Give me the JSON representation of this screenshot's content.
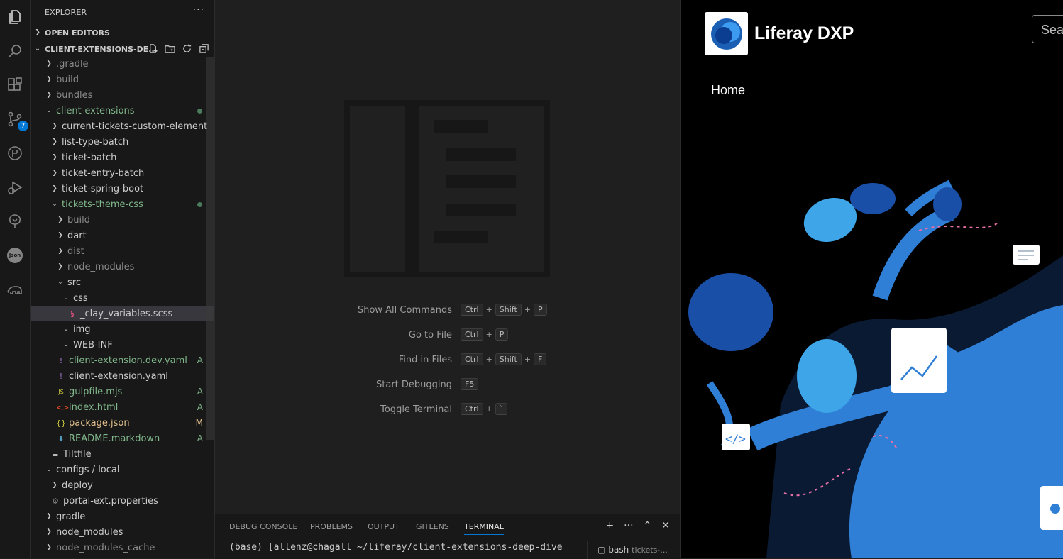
{
  "sidebar": {
    "title": "EXPLORER",
    "open_editors": "OPEN EDITORS",
    "workspace": "CLIENT-EXTENSIONS-DE...",
    "tree": [
      {
        "label": ".gradle",
        "depth": 0,
        "kind": "folder",
        "open": false,
        "color": "dim"
      },
      {
        "label": "build",
        "depth": 0,
        "kind": "folder",
        "open": false,
        "color": "dim"
      },
      {
        "label": "bundles",
        "depth": 0,
        "kind": "folder",
        "open": false,
        "color": "dim"
      },
      {
        "label": "client-extensions",
        "depth": 0,
        "kind": "folder",
        "open": true,
        "color": "green",
        "dot": true
      },
      {
        "label": "current-tickets-custom-element",
        "depth": 1,
        "kind": "folder",
        "open": false
      },
      {
        "label": "list-type-batch",
        "depth": 1,
        "kind": "folder",
        "open": false
      },
      {
        "label": "ticket-batch",
        "depth": 1,
        "kind": "folder",
        "open": false
      },
      {
        "label": "ticket-entry-batch",
        "depth": 1,
        "kind": "folder",
        "open": false
      },
      {
        "label": "ticket-spring-boot",
        "depth": 1,
        "kind": "folder",
        "open": false
      },
      {
        "label": "tickets-theme-css",
        "depth": 1,
        "kind": "folder",
        "open": true,
        "color": "green",
        "dot": true
      },
      {
        "label": "build",
        "depth": 2,
        "kind": "folder",
        "open": false,
        "color": "dim"
      },
      {
        "label": "dart",
        "depth": 2,
        "kind": "folder",
        "open": false
      },
      {
        "label": "dist",
        "depth": 2,
        "kind": "folder",
        "open": false,
        "color": "dim"
      },
      {
        "label": "node_modules",
        "depth": 2,
        "kind": "folder",
        "open": false,
        "color": "dim"
      },
      {
        "label": "src",
        "depth": 2,
        "kind": "folder",
        "open": true
      },
      {
        "label": "css",
        "depth": 3,
        "kind": "folder",
        "open": true
      },
      {
        "label": "_clay_variables.scss",
        "depth": 4,
        "kind": "scss",
        "selected": true
      },
      {
        "label": "img",
        "depth": 3,
        "kind": "folder",
        "open": true
      },
      {
        "label": "WEB-INF",
        "depth": 3,
        "kind": "folder",
        "open": true
      },
      {
        "label": "client-extension.dev.yaml",
        "depth": 2,
        "kind": "yaml",
        "color": "green",
        "status": "A"
      },
      {
        "label": "client-extension.yaml",
        "depth": 2,
        "kind": "yaml"
      },
      {
        "label": "gulpfile.mjs",
        "depth": 2,
        "kind": "js",
        "color": "green",
        "status": "A"
      },
      {
        "label": "index.html",
        "depth": 2,
        "kind": "html",
        "color": "green",
        "status": "A"
      },
      {
        "label": "package.json",
        "depth": 2,
        "kind": "json",
        "color": "yellow",
        "status": "M"
      },
      {
        "label": "README.markdown",
        "depth": 2,
        "kind": "md",
        "color": "green",
        "status": "A"
      },
      {
        "label": "Tiltfile",
        "depth": 1,
        "kind": "text"
      },
      {
        "label": "configs / local",
        "depth": 0,
        "kind": "folder",
        "open": true
      },
      {
        "label": "deploy",
        "depth": 1,
        "kind": "folder",
        "open": false
      },
      {
        "label": "portal-ext.properties",
        "depth": 1,
        "kind": "gear"
      },
      {
        "label": "gradle",
        "depth": 0,
        "kind": "folder",
        "open": false
      },
      {
        "label": "node_modules",
        "depth": 0,
        "kind": "folder",
        "open": false
      },
      {
        "label": "node_modules_cache",
        "depth": 0,
        "kind": "folder",
        "open": false,
        "color": "dim"
      }
    ]
  },
  "activity_bar": {
    "items": [
      "files-icon",
      "search-icon",
      "extensions-icon",
      "source-control-icon",
      "run-icon",
      "debug-icon",
      "tree-icon",
      "json-icon",
      "elephant-icon"
    ],
    "scm_badge": "7",
    "json_label": "Json"
  },
  "editor": {
    "shortcuts": [
      {
        "label": "Show All Commands",
        "keys": [
          "Ctrl",
          "Shift",
          "P"
        ]
      },
      {
        "label": "Go to File",
        "keys": [
          "Ctrl",
          "P"
        ]
      },
      {
        "label": "Find in Files",
        "keys": [
          "Ctrl",
          "Shift",
          "F"
        ]
      },
      {
        "label": "Start Debugging",
        "keys": [
          "F5"
        ]
      },
      {
        "label": "Toggle Terminal",
        "keys": [
          "Ctrl",
          "`"
        ]
      }
    ]
  },
  "panel": {
    "tabs": [
      "DEBUG CONSOLE",
      "PROBLEMS",
      "OUTPUT",
      "GITLENS",
      "TERMINAL"
    ],
    "active_tab": "TERMINAL",
    "terminal_line": "(base) [allenz@chagall ~/liferay/client-extensions-deep-dive",
    "terminal_name": "bash",
    "terminal_sub": "tickets-..."
  },
  "browser": {
    "site_title": "Liferay DXP",
    "search_placeholder": "Sea",
    "nav_home": "Home"
  },
  "colors": {
    "accent": "#0078d4",
    "git_added": "#81b88b",
    "git_modified": "#e2c08d",
    "hero_blue": "#2f7fd6"
  }
}
